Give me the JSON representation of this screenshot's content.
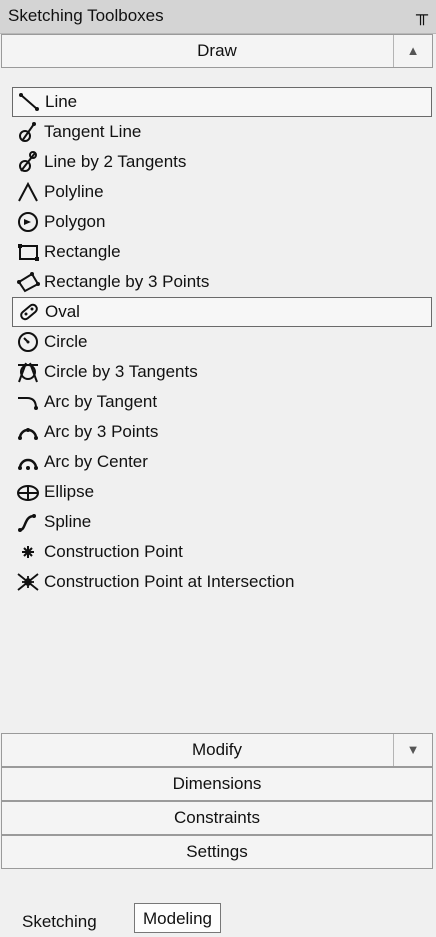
{
  "window": {
    "title": "Sketching Toolboxes",
    "pin_glyph": "╥"
  },
  "sections": {
    "draw": "Draw",
    "modify": "Modify",
    "dimensions": "Dimensions",
    "constraints": "Constraints",
    "settings": "Settings"
  },
  "draw_items": [
    {
      "label": "Line",
      "icon": "line-icon"
    },
    {
      "label": "Tangent Line",
      "icon": "tangent-line-icon"
    },
    {
      "label": "Line by 2 Tangents",
      "icon": "line-by-2-tangents-icon"
    },
    {
      "label": "Polyline",
      "icon": "polyline-icon"
    },
    {
      "label": "Polygon",
      "icon": "polygon-icon"
    },
    {
      "label": "Rectangle",
      "icon": "rectangle-icon"
    },
    {
      "label": "Rectangle by 3 Points",
      "icon": "rectangle-by-3-points-icon"
    },
    {
      "label": "Oval",
      "icon": "oval-icon"
    },
    {
      "label": "Circle",
      "icon": "circle-icon"
    },
    {
      "label": "Circle by 3 Tangents",
      "icon": "circle-by-3-tangents-icon"
    },
    {
      "label": "Arc by Tangent",
      "icon": "arc-by-tangent-icon"
    },
    {
      "label": "Arc by 3 Points",
      "icon": "arc-by-3-points-icon"
    },
    {
      "label": "Arc by Center",
      "icon": "arc-by-center-icon"
    },
    {
      "label": "Ellipse",
      "icon": "ellipse-icon"
    },
    {
      "label": "Spline",
      "icon": "spline-icon"
    },
    {
      "label": "Construction Point",
      "icon": "construction-point-icon"
    },
    {
      "label": "Construction Point at Intersection",
      "icon": "construction-point-intersection-icon"
    }
  ],
  "tabs": {
    "sketching": "Sketching",
    "modeling": "Modeling"
  }
}
